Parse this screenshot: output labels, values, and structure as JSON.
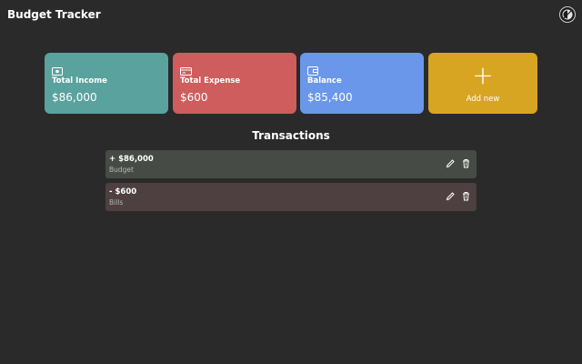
{
  "header": {
    "title": "Budget Tracker",
    "theme_toggle_icon": "theme-toggle-icon"
  },
  "cards": {
    "income": {
      "label": "Total Income",
      "value": "$86,000",
      "icon": "cash-icon",
      "color": "#5aa29d"
    },
    "expense": {
      "label": "Total Expense",
      "value": "$600",
      "icon": "credit-card-icon",
      "color": "#cf5d5d"
    },
    "balance": {
      "label": "Balance",
      "value": "$85,400",
      "icon": "wallet-icon",
      "color": "#6a97ea"
    },
    "add_new": {
      "symbol": "+",
      "label": "Add new",
      "color": "#d8a523"
    }
  },
  "transactions": {
    "title": "Transactions",
    "items": [
      {
        "amount": "+ $86,000",
        "category": "Budget",
        "type": "income"
      },
      {
        "amount": "- $600",
        "category": "Bills",
        "type": "expense"
      }
    ]
  }
}
